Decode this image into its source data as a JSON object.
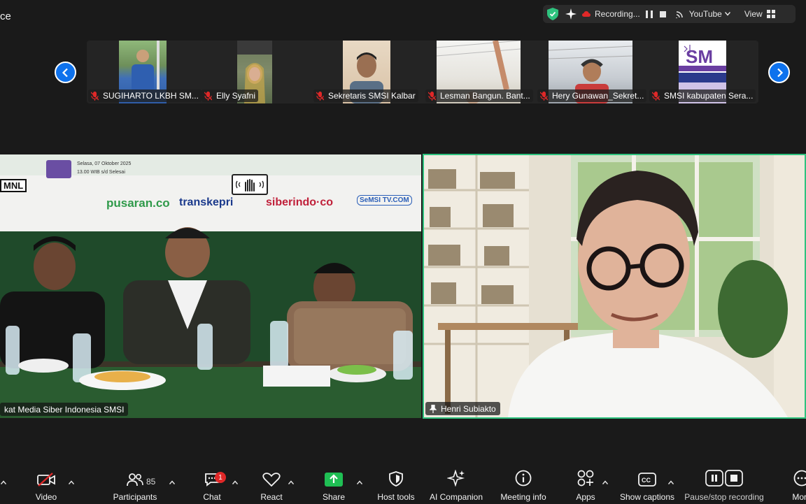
{
  "window": {
    "title_fragment": "ce"
  },
  "status_bar": {
    "recording_label": "Recording...",
    "stream_label": "YouTube",
    "view_label": "View"
  },
  "participants_strip": [
    {
      "name": "SUGIHARTO LKBH SM...",
      "muted": true
    },
    {
      "name": "Elly Syafni",
      "muted": true
    },
    {
      "name": "Sekretaris SMSI Kalbar",
      "muted": true
    },
    {
      "name": "Lesman Bangun. Bant...",
      "muted": true
    },
    {
      "name": "Hery Gunawan_Sekret...",
      "muted": true
    },
    {
      "name": "SMSI kabupaten Sera...",
      "muted": true
    }
  ],
  "main_videos": {
    "left_name": "kat Media Siber Indonesia SMSI",
    "right_name": "Henri Subiakto",
    "banner": {
      "date_line": "Selasa, 07 Oktober 2025",
      "time_line": "13.00 WIB s/d Selesai",
      "brands": [
        "MNL",
        "pusaran.co",
        "transkepri",
        "siberindo·co",
        "SeMSI TV.COM"
      ]
    }
  },
  "toolbar": {
    "video_label": "Video",
    "participants_label": "Participants",
    "participants_count": "85",
    "chat_label": "Chat",
    "chat_badge": "1",
    "react_label": "React",
    "share_label": "Share",
    "host_tools_label": "Host tools",
    "ai_companion_label": "AI Companion",
    "meeting_info_label": "Meeting info",
    "apps_label": "Apps",
    "captions_label": "Show captions",
    "recording_label": "Pause/stop recording",
    "more_label": "More"
  },
  "colors": {
    "accent_blue": "#0e72ed",
    "active_speaker": "#2ec27e",
    "muted_red": "#e02828",
    "share_green": "#1fbf54"
  }
}
